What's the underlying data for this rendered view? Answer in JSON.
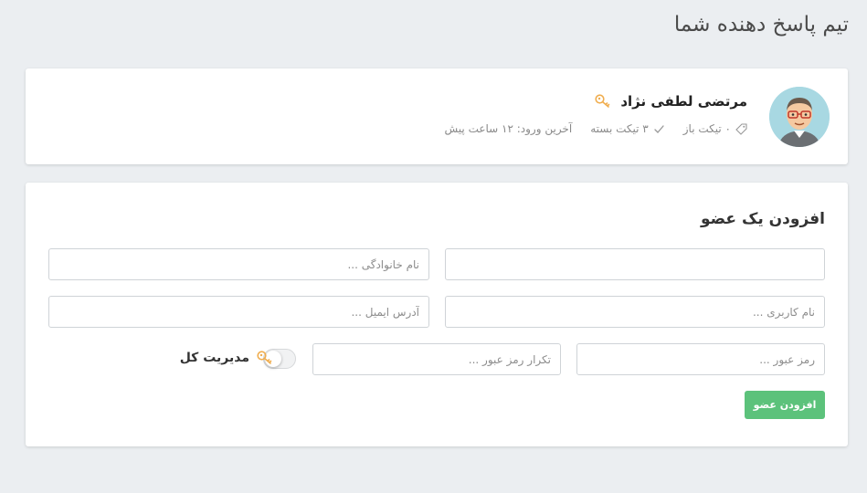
{
  "page": {
    "title": "تیم پاسخ دهنده شما"
  },
  "member": {
    "name": "مرتضی لطفی نژاد",
    "open_tickets": "۰ تیکت باز",
    "closed_tickets": "۳ تیکت بسته",
    "last_login": "آخرین ورود: ۱۲ ساعت پیش",
    "avatar_icon": "person-avatar-icon",
    "role_icon": "key-icon"
  },
  "add_member_form": {
    "title": "افزودن یک عضو",
    "first_name": {
      "value": "",
      "placeholder": ""
    },
    "last_name": {
      "value": "",
      "placeholder": "نام خانوادگی ..."
    },
    "username": {
      "value": "",
      "placeholder": "نام کاربری ..."
    },
    "email": {
      "value": "",
      "placeholder": "آدرس ایمیل ..."
    },
    "password": {
      "value": "",
      "placeholder": "رمز عبور ..."
    },
    "password_confirm": {
      "value": "",
      "placeholder": "تکرار رمز عبور ..."
    },
    "admin_toggle": {
      "label": "مدیریت کل",
      "checked": false
    },
    "submit_label": "افزودن عضو"
  },
  "colors": {
    "background": "#ebeef1",
    "accent_green": "#5cc27b",
    "key_orange": "#f0ad4e"
  }
}
